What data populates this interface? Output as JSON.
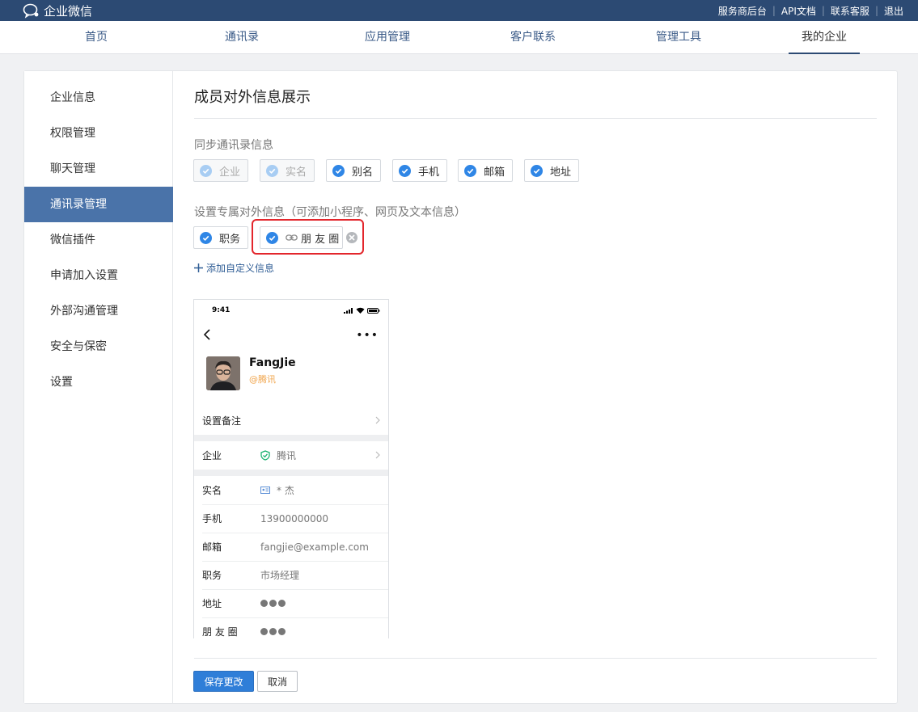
{
  "app": {
    "logo_text": "企业微信"
  },
  "toplinks": [
    "服务商后台",
    "API文档",
    "联系客服",
    "退出"
  ],
  "nav": [
    {
      "label": "首页"
    },
    {
      "label": "通讯录"
    },
    {
      "label": "应用管理"
    },
    {
      "label": "客户联系"
    },
    {
      "label": "管理工具"
    },
    {
      "label": "我的企业",
      "active": true
    }
  ],
  "sidebar": [
    {
      "label": "企业信息"
    },
    {
      "label": "权限管理"
    },
    {
      "label": "聊天管理"
    },
    {
      "label": "通讯录管理",
      "active": true
    },
    {
      "label": "微信插件"
    },
    {
      "label": "申请加入设置"
    },
    {
      "label": "外部沟通管理"
    },
    {
      "label": "安全与保密"
    },
    {
      "label": "设置"
    }
  ],
  "page": {
    "title": "成员对外信息展示",
    "sync_label": "同步通讯录信息",
    "sync_chips": [
      {
        "label": "企业",
        "disabled": true
      },
      {
        "label": "实名",
        "disabled": true
      },
      {
        "label": "别名"
      },
      {
        "label": "手机"
      },
      {
        "label": "邮箱"
      },
      {
        "label": "地址"
      }
    ],
    "custom_label": "设置专属对外信息（可添加小程序、网页及文本信息）",
    "custom_chips": [
      {
        "label": "职务"
      },
      {
        "label": "朋 友 圈",
        "type": "link"
      }
    ],
    "add_custom": "添加自定义信息"
  },
  "preview": {
    "time": "9:41",
    "name": "FangJie",
    "corp": "@腾讯",
    "remark_label": "设置备注",
    "corp_row": {
      "label": "企业",
      "value": "腾讯"
    },
    "rows": [
      {
        "label": "实名",
        "value": "* 杰"
      },
      {
        "label": "手机",
        "value": "13900000000"
      },
      {
        "label": "邮箱",
        "value": "fangjie@example.com"
      },
      {
        "label": "职务",
        "value": "市场经理"
      },
      {
        "label": "地址",
        "value": ""
      },
      {
        "label": "朋 友 圈",
        "value": ""
      }
    ]
  },
  "buttons": {
    "save": "保存更改",
    "cancel": "取消"
  },
  "colors": {
    "topbar": "#2c4a73",
    "accent": "#2f7ed8",
    "sidebar_active": "#4a73a9",
    "highlight": "#e3262c",
    "corp_tag": "#f0a44a"
  }
}
